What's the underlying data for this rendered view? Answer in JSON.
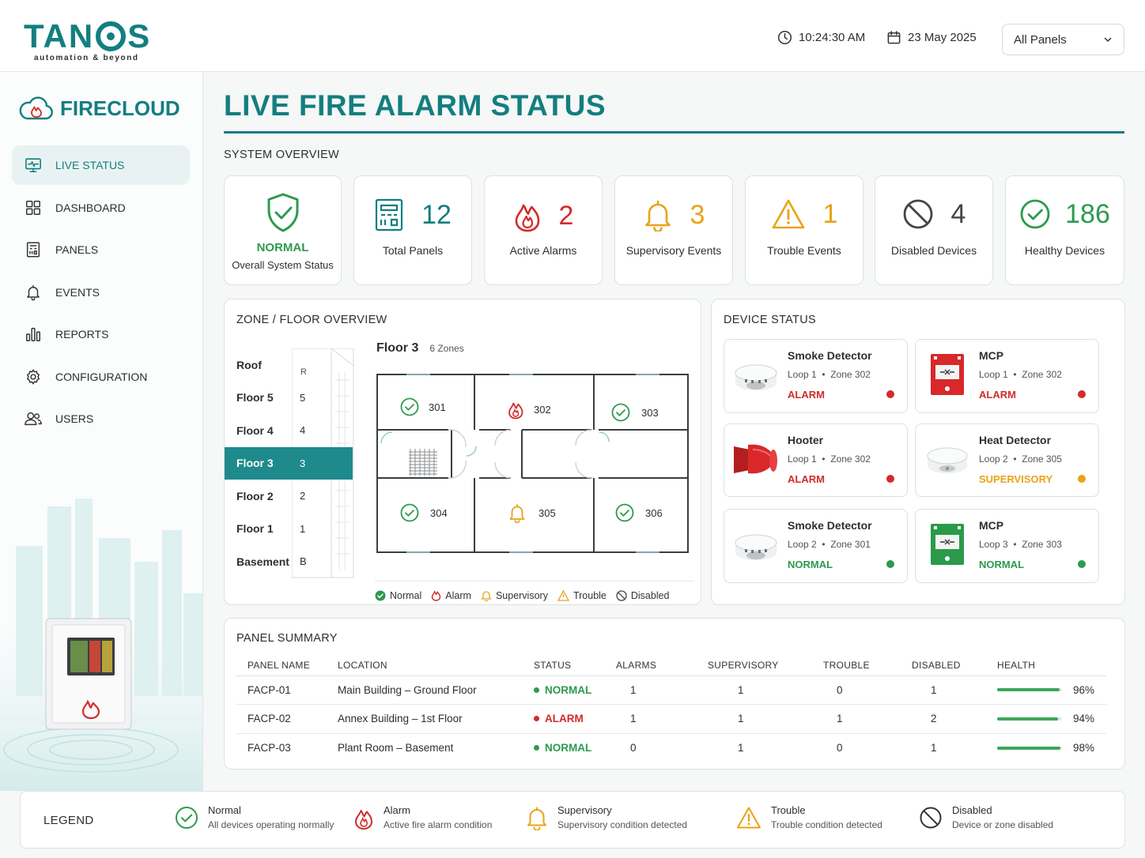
{
  "header": {
    "logo_text": "TANOS",
    "logo_tagline": "automation & beyond",
    "time": "10:24:30 AM",
    "date": "23 May 2025",
    "panel_filter": "All Panels"
  },
  "sidebar": {
    "brand": "FIRECLOUD",
    "items": [
      {
        "label": "LIVE STATUS",
        "icon": "monitor-icon",
        "active": true
      },
      {
        "label": "DASHBOARD",
        "icon": "grid-icon"
      },
      {
        "label": "PANELS",
        "icon": "panel-icon"
      },
      {
        "label": "EVENTS",
        "icon": "bell-icon"
      },
      {
        "label": "REPORTS",
        "icon": "bar-chart-icon"
      },
      {
        "label": "CONFIGURATION",
        "icon": "gear-icon"
      },
      {
        "label": "USERS",
        "icon": "users-icon"
      }
    ]
  },
  "page": {
    "title": "LIVE FIRE ALARM STATUS",
    "system_overview_label": "SYSTEM OVERVIEW"
  },
  "overview": {
    "status": {
      "value": "NORMAL",
      "label": "Overall System Status"
    },
    "cards": [
      {
        "value": "12",
        "label": "Total Panels",
        "icon": "panel-icon",
        "color": "#137e80"
      },
      {
        "value": "2",
        "label": "Active Alarms",
        "icon": "fire-icon",
        "color": "#d22b2b"
      },
      {
        "value": "3",
        "label": "Supervisory Events",
        "icon": "bell-icon",
        "color": "#e8a317"
      },
      {
        "value": "1",
        "label": "Trouble Events",
        "icon": "warning-icon",
        "color": "#e8a317"
      },
      {
        "value": "4",
        "label": "Disabled Devices",
        "icon": "disabled-icon",
        "color": "#444444"
      },
      {
        "value": "186",
        "label": "Healthy Devices",
        "icon": "check-circle-icon",
        "color": "#2d9a4e"
      }
    ]
  },
  "zone_overview": {
    "label": "ZONE / FLOOR OVERVIEW",
    "roof_marker": "R",
    "floors": [
      {
        "name": "Roof",
        "num": ""
      },
      {
        "name": "Floor 5",
        "num": "5"
      },
      {
        "name": "Floor 4",
        "num": "4"
      },
      {
        "name": "Floor 3",
        "num": "3",
        "selected": true
      },
      {
        "name": "Floor 2",
        "num": "2"
      },
      {
        "name": "Floor 1",
        "num": "1"
      },
      {
        "name": "Basement",
        "num": "B"
      }
    ],
    "selected_floor": "Floor 3",
    "zone_count": "6 Zones",
    "zones": [
      {
        "id": "301",
        "status": "normal"
      },
      {
        "id": "302",
        "status": "alarm"
      },
      {
        "id": "303",
        "status": "normal"
      },
      {
        "id": "304",
        "status": "normal"
      },
      {
        "id": "305",
        "status": "supervisory"
      },
      {
        "id": "306",
        "status": "normal"
      }
    ],
    "legend": [
      "Normal",
      "Alarm",
      "Supervisory",
      "Trouble",
      "Disabled"
    ]
  },
  "device_status": {
    "label": "DEVICE STATUS",
    "devices": [
      {
        "name": "Smoke Detector",
        "loop": "Loop 1",
        "zone": "Zone 302",
        "status": "ALARM",
        "color": "#d22b2b",
        "icon": "smoke-detector-icon"
      },
      {
        "name": "MCP",
        "loop": "Loop 1",
        "zone": "Zone 302",
        "status": "ALARM",
        "color": "#d22b2b",
        "icon": "mcp-red-icon"
      },
      {
        "name": "Hooter",
        "loop": "Loop 1",
        "zone": "Zone 302",
        "status": "ALARM",
        "color": "#d22b2b",
        "icon": "hooter-icon"
      },
      {
        "name": "Heat Detector",
        "loop": "Loop 2",
        "zone": "Zone 305",
        "status": "SUPERVISORY",
        "color": "#e8a317",
        "icon": "heat-detector-icon"
      },
      {
        "name": "Smoke Detector",
        "loop": "Loop 2",
        "zone": "Zone 301",
        "status": "NORMAL",
        "color": "#2d9a4e",
        "icon": "smoke-detector-icon"
      },
      {
        "name": "MCP",
        "loop": "Loop 3",
        "zone": "Zone 303",
        "status": "NORMAL",
        "color": "#2d9a4e",
        "icon": "mcp-green-icon"
      }
    ]
  },
  "panel_summary": {
    "label": "PANEL SUMMARY",
    "columns": [
      "PANEL NAME",
      "LOCATION",
      "STATUS",
      "ALARMS",
      "SUPERVISORY",
      "TROUBLE",
      "DISABLED",
      "HEALTH"
    ],
    "rows": [
      {
        "name": "FACP-01",
        "location": "Main Building – Ground Floor",
        "status": "NORMAL",
        "status_color": "#2d9a4e",
        "alarms": "1",
        "supervisory": "1",
        "trouble": "0",
        "disabled": "1",
        "health": "96%",
        "health_value": 0.96
      },
      {
        "name": "FACP-02",
        "location": "Annex Building – 1st Floor",
        "status": "ALARM",
        "status_color": "#d22b2b",
        "alarms": "1",
        "supervisory": "1",
        "trouble": "1",
        "disabled": "2",
        "health": "94%",
        "health_value": 0.94
      },
      {
        "name": "FACP-03",
        "location": "Plant Room – Basement",
        "status": "NORMAL",
        "status_color": "#2d9a4e",
        "alarms": "0",
        "supervisory": "1",
        "trouble": "0",
        "disabled": "1",
        "health": "98%",
        "health_value": 0.98
      }
    ]
  },
  "legend": {
    "title": "LEGEND",
    "items": [
      {
        "name": "Normal",
        "desc": "All devices operating normally",
        "icon": "check-circle-icon"
      },
      {
        "name": "Alarm",
        "desc": "Active fire alarm condition",
        "icon": "fire-icon"
      },
      {
        "name": "Supervisory",
        "desc": "Supervisory condition detected",
        "icon": "bell-icon"
      },
      {
        "name": "Trouble",
        "desc": "Trouble condition detected",
        "icon": "warning-icon"
      },
      {
        "name": "Disabled",
        "desc": "Device or zone disabled",
        "icon": "disabled-icon"
      }
    ]
  },
  "colors": {
    "accent": "#137e80",
    "alarm": "#d22b2b",
    "supervisory": "#e8a317",
    "normal": "#2d9a4e"
  }
}
